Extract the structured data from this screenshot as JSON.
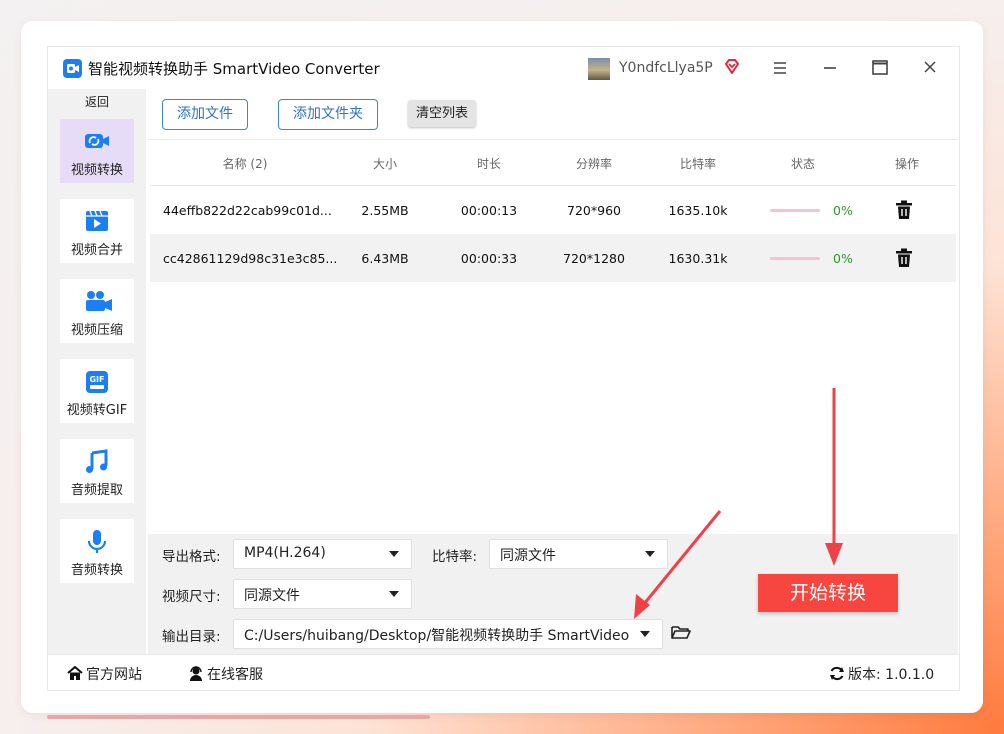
{
  "app": {
    "title": "智能视频转换助手 SmartVideo Converter",
    "username": "Y0ndfcLlya5P",
    "accent_color": "#f6463f",
    "brand_color": "#1b7ff2"
  },
  "window_controls": [
    "menu-icon",
    "minimize-icon",
    "maximize-icon",
    "close-icon"
  ],
  "sidebar": {
    "back_label": "返回",
    "items": [
      {
        "label": "视频转换",
        "icon": "video-convert-icon",
        "active": true
      },
      {
        "label": "视频合并",
        "icon": "video-merge-icon",
        "active": false
      },
      {
        "label": "视频压缩",
        "icon": "video-compress-icon",
        "active": false
      },
      {
        "label": "视频转GIF",
        "icon": "gif-icon",
        "active": false
      },
      {
        "label": "音频提取",
        "icon": "music-note-icon",
        "active": false
      },
      {
        "label": "音频转换",
        "icon": "microphone-icon",
        "active": false
      }
    ]
  },
  "toolbar": {
    "add_file": "添加文件",
    "add_folder": "添加文件夹",
    "clear_list": "清空列表"
  },
  "table": {
    "columns": [
      "名称 (2)",
      "大小",
      "时长",
      "分辨率",
      "比特率",
      "状态",
      "操作"
    ],
    "rows": [
      {
        "name": "44effb822d22cab99c01d...",
        "size": "2.55MB",
        "duration": "00:00:13",
        "resolution": "720*960",
        "bitrate": "1635.10k",
        "progress": 0,
        "progress_text": "0%"
      },
      {
        "name": "cc42861129d98c31e3c85...",
        "size": "6.43MB",
        "duration": "00:00:33",
        "resolution": "720*1280",
        "bitrate": "1630.31k",
        "progress": 0,
        "progress_text": "0%"
      }
    ]
  },
  "settings": {
    "format_label": "导出格式:",
    "format_value": "MP4(H.264)",
    "bitrate_label": "比特率:",
    "bitrate_value": "同源文件",
    "size_label": "视频尺寸:",
    "size_value": "同源文件",
    "output_label": "输出目录:",
    "output_value": "C:/Users/huibang/Desktop/智能视频转换助手 SmartVideo",
    "start_label": "开始转换"
  },
  "footer": {
    "website": "官方网站",
    "support": "在线客服",
    "version_label": "版本:",
    "version": "1.0.1.0"
  }
}
